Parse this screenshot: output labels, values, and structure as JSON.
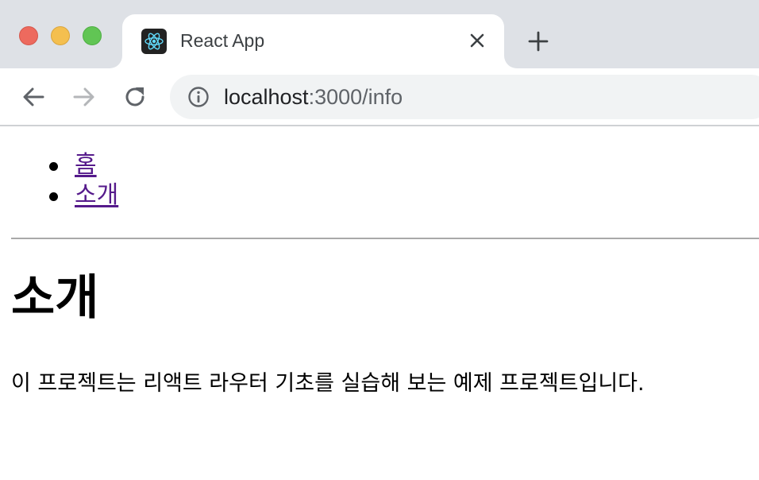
{
  "browser": {
    "tab_title": "React App",
    "url_host": "localhost",
    "url_rest": ":3000/info",
    "icons": {
      "close": "close-icon",
      "new_tab": "plus-icon",
      "back": "back-arrow-icon",
      "forward": "forward-arrow-icon",
      "reload": "reload-icon",
      "site_info": "info-icon",
      "favicon": "react-logo-icon"
    },
    "colors": {
      "tabstrip": "#dee1e6",
      "omnibox": "#f1f3f4",
      "close_button": "#ed6a5e",
      "minimize_button": "#f4bf4f",
      "zoom_button": "#61c554"
    }
  },
  "page": {
    "nav": [
      {
        "label": "홈"
      },
      {
        "label": "소개"
      }
    ],
    "heading": "소개",
    "paragraph": "이 프로젝트는 리액트 라우터 기초를 실습해 보는 예제 프로젝트입니다.",
    "colors": {
      "link_visited": "#551a8b"
    }
  }
}
